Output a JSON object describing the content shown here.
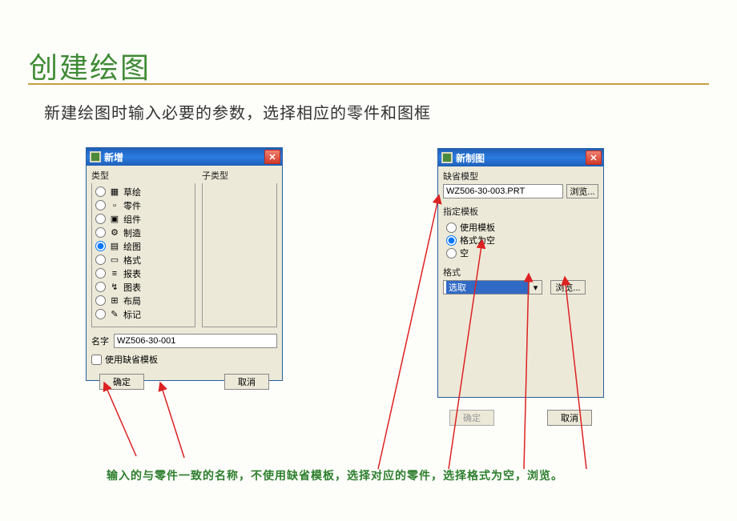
{
  "slide": {
    "title": "创建绘图",
    "subtitle": "新建绘图时输入必要的参数，选择相应的零件和图框",
    "annotation": "输入的与零件一致的名称，不使用缺省模板，选择对应的零件，选择格式为空，浏览。"
  },
  "dialog1": {
    "title": "新增",
    "type_label": "类型",
    "subtype_label": "子类型",
    "types": [
      {
        "label": "草绘"
      },
      {
        "label": "零件"
      },
      {
        "label": "组件"
      },
      {
        "label": "制造"
      },
      {
        "label": "绘图"
      },
      {
        "label": "格式"
      },
      {
        "label": "报表"
      },
      {
        "label": "图表"
      },
      {
        "label": "布局"
      },
      {
        "label": "标记"
      }
    ],
    "selected_type_index": 4,
    "name_label": "名字",
    "name_value": "WZ506-30-001",
    "default_template_label": "使用缺省模板",
    "default_template_checked": false,
    "ok": "确定",
    "cancel": "取消"
  },
  "dialog2": {
    "title": "新制图",
    "default_model_label": "缺省模型",
    "default_model_value": "WZ506-30-003.PRT",
    "browse": "浏览...",
    "template_group_label": "指定模板",
    "template_options": [
      {
        "label": "使用模板"
      },
      {
        "label": "格式为空"
      },
      {
        "label": "空"
      }
    ],
    "template_selected_index": 1,
    "format_label": "格式",
    "format_selected": "选取",
    "ok": "确定",
    "cancel": "取消"
  },
  "icons": {
    "sketch": "▦",
    "part": "▫",
    "assembly": "▣",
    "mfg": "⚙",
    "drawing": "▤",
    "format": "▭",
    "report": "≡",
    "chart": "↯",
    "layout": "⊞",
    "markup": "✎"
  }
}
